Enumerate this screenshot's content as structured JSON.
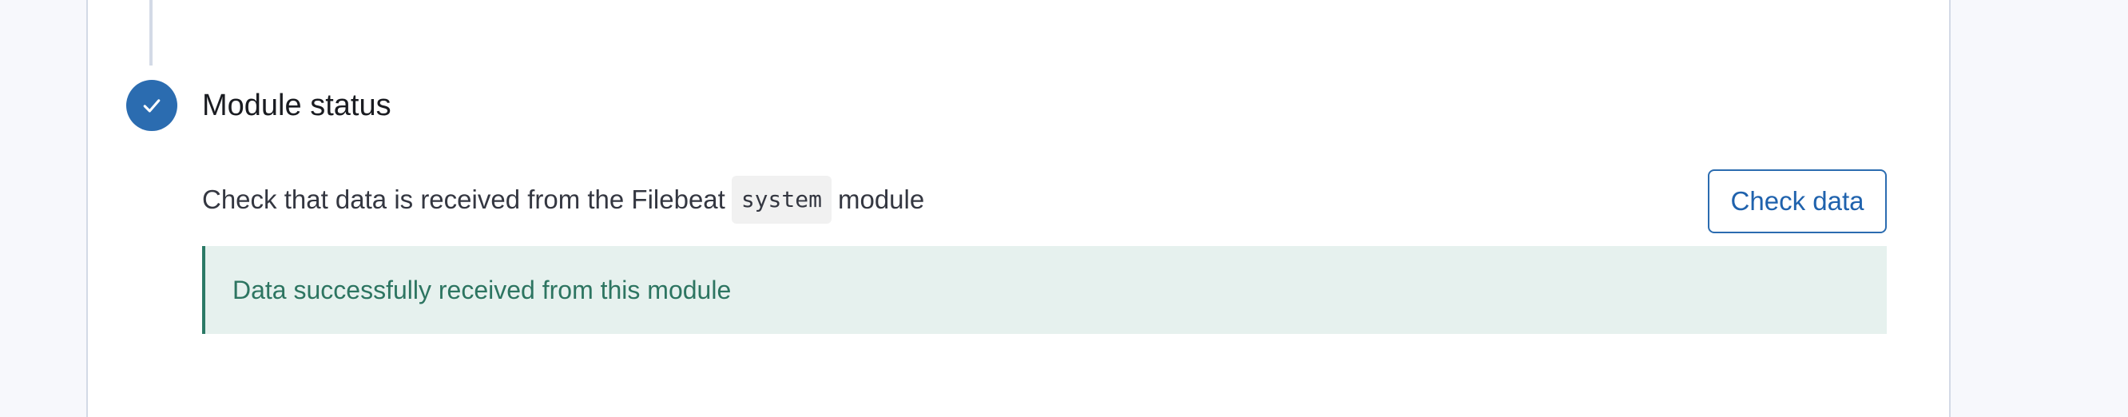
{
  "step": {
    "title": "Module status",
    "status": "complete",
    "icon": "check-icon",
    "accent_color": "#2b6cb0"
  },
  "description": {
    "prefix": "Check that data is received from the Filebeat",
    "code": "system",
    "suffix": "module"
  },
  "actions": {
    "check_data_label": "Check data"
  },
  "callout": {
    "message": "Data successfully received from this module",
    "color": "#2d7561",
    "background": "#e6f1ee"
  }
}
